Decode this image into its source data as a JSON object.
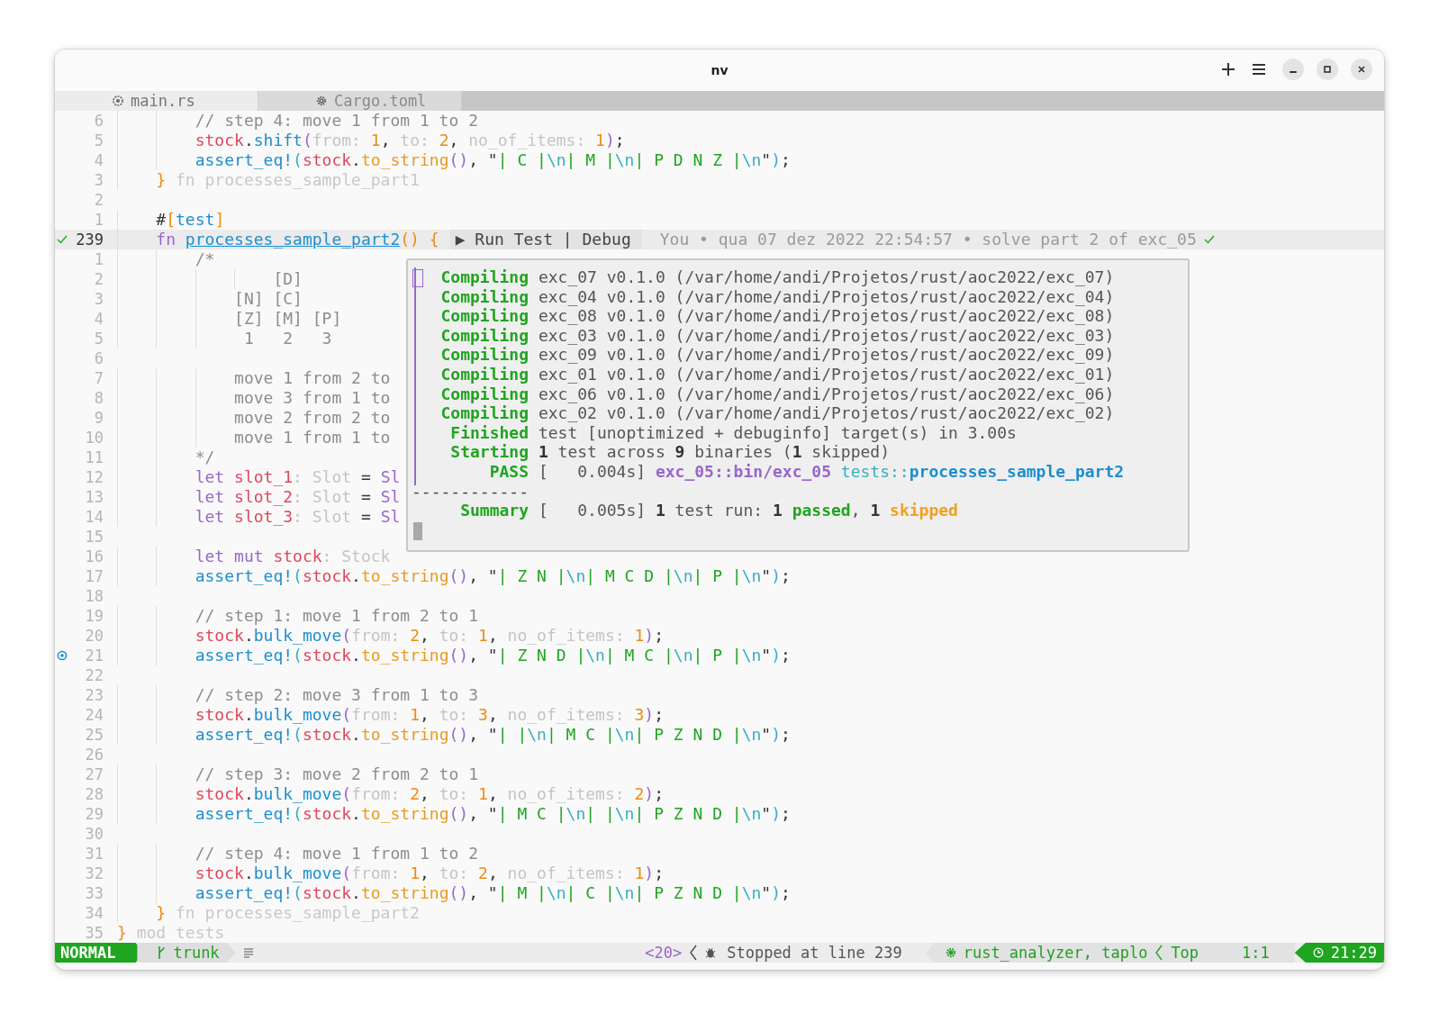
{
  "window": {
    "title": "nv"
  },
  "tabs": [
    {
      "label": "main.rs",
      "kind": "rust",
      "selected": true
    },
    {
      "label": "Cargo.toml",
      "kind": "toml",
      "selected": false
    }
  ],
  "editor": {
    "lines": [
      {
        "number": "6",
        "current": false,
        "tokens": [
          {
            "kind": "comment",
            "text": "        // step 4: move 1 from 1 to 2"
          }
        ]
      },
      {
        "number": "5",
        "current": false,
        "tokens": [
          {
            "kind": "var",
            "text": "        stock"
          },
          {
            "kind": "plain",
            "text": "."
          },
          {
            "kind": "fn",
            "text": "shift"
          },
          {
            "kind": "p2",
            "text": "("
          },
          {
            "kind": "hint",
            "text": "from: "
          },
          {
            "kind": "num",
            "text": "1"
          },
          {
            "kind": "plain",
            "text": ", "
          },
          {
            "kind": "hint",
            "text": "to: "
          },
          {
            "kind": "num",
            "text": "2"
          },
          {
            "kind": "plain",
            "text": ", "
          },
          {
            "kind": "hint",
            "text": "no_of_items: "
          },
          {
            "kind": "num",
            "text": "1"
          },
          {
            "kind": "p2",
            "text": ")"
          },
          {
            "kind": "plain",
            "text": ";"
          }
        ]
      },
      {
        "number": "4",
        "current": false,
        "tokens": [
          {
            "kind": "fn",
            "text": "        assert_eq!"
          },
          {
            "kind": "p1",
            "text": "("
          },
          {
            "kind": "var",
            "text": "stock"
          },
          {
            "kind": "plain",
            "text": "."
          },
          {
            "kind": "method",
            "text": "to_string"
          },
          {
            "kind": "p2",
            "text": "()"
          },
          {
            "kind": "plain",
            "text": ", \""
          },
          {
            "kind": "str",
            "text": "| C |"
          },
          {
            "kind": "esc",
            "text": "\\n"
          },
          {
            "kind": "str",
            "text": "| M |"
          },
          {
            "kind": "esc",
            "text": "\\n"
          },
          {
            "kind": "str",
            "text": "| P D N Z |"
          },
          {
            "kind": "esc",
            "text": "\\n"
          },
          {
            "kind": "plain",
            "text": "\""
          },
          {
            "kind": "p1",
            "text": ")"
          },
          {
            "kind": "plain",
            "text": ";"
          }
        ]
      },
      {
        "number": "3",
        "current": false,
        "tokens": [
          {
            "kind": "brace",
            "text": "    }"
          },
          {
            "kind": "ghost",
            "text": " fn processes_sample_part1"
          }
        ]
      },
      {
        "number": "2",
        "current": false
      },
      {
        "number": "1",
        "current": false,
        "tokens": [
          {
            "kind": "plain",
            "text": "    #"
          },
          {
            "kind": "brace",
            "text": "["
          },
          {
            "kind": "fn",
            "text": "test"
          },
          {
            "kind": "brace",
            "text": "]"
          }
        ]
      },
      {
        "number": "239",
        "current": true,
        "test_passed": true,
        "tokens": [
          {
            "kind": "kw",
            "text": "    fn "
          },
          {
            "kind": "fname",
            "text": "processes_sample_part2"
          },
          {
            "kind": "brace",
            "text": "()"
          },
          {
            "kind": "brace",
            "text": " {"
          }
        ],
        "lens": "▶ Run Test | Debug",
        "blame": "You • qua 07 dez 2022 22:54:57 • solve part 2 of exc_05"
      },
      {
        "number": "1",
        "current": false,
        "tokens": [
          {
            "kind": "comment",
            "text": "        /*"
          }
        ]
      },
      {
        "number": "2",
        "current": false,
        "tokens": [
          {
            "kind": "comment",
            "text": "                [D]"
          }
        ]
      },
      {
        "number": "3",
        "current": false,
        "tokens": [
          {
            "kind": "comment",
            "text": "            [N] [C]"
          }
        ]
      },
      {
        "number": "4",
        "current": false,
        "tokens": [
          {
            "kind": "comment",
            "text": "            [Z] [M] [P]"
          }
        ]
      },
      {
        "number": "5",
        "current": false,
        "tokens": [
          {
            "kind": "comment",
            "text": "             1   2   3"
          }
        ]
      },
      {
        "number": "6",
        "current": false
      },
      {
        "number": "7",
        "current": false,
        "tokens": [
          {
            "kind": "comment",
            "text": "            move 1 from 2 to"
          }
        ]
      },
      {
        "number": "8",
        "current": false,
        "tokens": [
          {
            "kind": "comment",
            "text": "            move 3 from 1 to"
          }
        ]
      },
      {
        "number": "9",
        "current": false,
        "tokens": [
          {
            "kind": "comment",
            "text": "            move 2 from 2 to"
          }
        ]
      },
      {
        "number": "10",
        "current": false,
        "tokens": [
          {
            "kind": "comment",
            "text": "            move 1 from 1 to"
          }
        ]
      },
      {
        "number": "11",
        "current": false,
        "tokens": [
          {
            "kind": "comment",
            "text": "        */"
          }
        ]
      },
      {
        "number": "12",
        "current": false,
        "tokens": [
          {
            "kind": "kw",
            "text": "        let "
          },
          {
            "kind": "var",
            "text": "slot_1"
          },
          {
            "kind": "hint",
            "text": ": Slot"
          },
          {
            "kind": "plain",
            "text": " = "
          },
          {
            "kind": "kw",
            "text": "Sl"
          }
        ]
      },
      {
        "number": "13",
        "current": false,
        "tokens": [
          {
            "kind": "kw",
            "text": "        let "
          },
          {
            "kind": "var",
            "text": "slot_2"
          },
          {
            "kind": "hint",
            "text": ": Slot"
          },
          {
            "kind": "plain",
            "text": " = "
          },
          {
            "kind": "kw",
            "text": "Sl"
          }
        ]
      },
      {
        "number": "14",
        "current": false,
        "tokens": [
          {
            "kind": "kw",
            "text": "        let "
          },
          {
            "kind": "var",
            "text": "slot_3"
          },
          {
            "kind": "hint",
            "text": ": Slot"
          },
          {
            "kind": "plain",
            "text": " = "
          },
          {
            "kind": "kw",
            "text": "Sl"
          }
        ]
      },
      {
        "number": "15",
        "current": false
      },
      {
        "number": "16",
        "current": false,
        "tokens": [
          {
            "kind": "kw",
            "text": "        let mut "
          },
          {
            "kind": "var",
            "text": "stock"
          },
          {
            "kind": "hint",
            "text": ": Stock"
          }
        ]
      },
      {
        "number": "17",
        "current": false,
        "tokens": [
          {
            "kind": "fn",
            "text": "        assert_eq!"
          },
          {
            "kind": "p1",
            "text": "("
          },
          {
            "kind": "var",
            "text": "stock"
          },
          {
            "kind": "plain",
            "text": "."
          },
          {
            "kind": "method",
            "text": "to_string"
          },
          {
            "kind": "p2",
            "text": "()"
          },
          {
            "kind": "plain",
            "text": ", \""
          },
          {
            "kind": "str",
            "text": "| Z N |"
          },
          {
            "kind": "esc",
            "text": "\\n"
          },
          {
            "kind": "str",
            "text": "| M C D |"
          },
          {
            "kind": "esc",
            "text": "\\n"
          },
          {
            "kind": "str",
            "text": "| P |"
          },
          {
            "kind": "esc",
            "text": "\\n"
          },
          {
            "kind": "plain",
            "text": "\""
          },
          {
            "kind": "p1",
            "text": ")"
          },
          {
            "kind": "plain",
            "text": ";"
          }
        ]
      },
      {
        "number": "18",
        "current": false
      },
      {
        "number": "19",
        "current": false,
        "tokens": [
          {
            "kind": "comment",
            "text": "        // step 1: move 1 from 2 to 1"
          }
        ]
      },
      {
        "number": "20",
        "current": false,
        "tokens": [
          {
            "kind": "var",
            "text": "        stock"
          },
          {
            "kind": "plain",
            "text": "."
          },
          {
            "kind": "fn",
            "text": "bulk_move"
          },
          {
            "kind": "p2",
            "text": "("
          },
          {
            "kind": "hint",
            "text": "from: "
          },
          {
            "kind": "num",
            "text": "2"
          },
          {
            "kind": "plain",
            "text": ", "
          },
          {
            "kind": "hint",
            "text": "to: "
          },
          {
            "kind": "num",
            "text": "1"
          },
          {
            "kind": "plain",
            "text": ", "
          },
          {
            "kind": "hint",
            "text": "no_of_items: "
          },
          {
            "kind": "num",
            "text": "1"
          },
          {
            "kind": "p2",
            "text": ")"
          },
          {
            "kind": "plain",
            "text": ";"
          }
        ]
      },
      {
        "number": "21",
        "current": false,
        "breakpoint": true,
        "tokens": [
          {
            "kind": "fn",
            "text": "        assert_eq!"
          },
          {
            "kind": "p1",
            "text": "("
          },
          {
            "kind": "var",
            "text": "stock"
          },
          {
            "kind": "plain",
            "text": "."
          },
          {
            "kind": "method",
            "text": "to_string"
          },
          {
            "kind": "p2",
            "text": "()"
          },
          {
            "kind": "plain",
            "text": ", \""
          },
          {
            "kind": "str",
            "text": "| Z N D |"
          },
          {
            "kind": "esc",
            "text": "\\n"
          },
          {
            "kind": "str",
            "text": "| M C |"
          },
          {
            "kind": "esc",
            "text": "\\n"
          },
          {
            "kind": "str",
            "text": "| P |"
          },
          {
            "kind": "esc",
            "text": "\\n"
          },
          {
            "kind": "plain",
            "text": "\""
          },
          {
            "kind": "p1",
            "text": ")"
          },
          {
            "kind": "plain",
            "text": ";"
          }
        ]
      },
      {
        "number": "22",
        "current": false
      },
      {
        "number": "23",
        "current": false,
        "tokens": [
          {
            "kind": "comment",
            "text": "        // step 2: move 3 from 1 to 3"
          }
        ]
      },
      {
        "number": "24",
        "current": false,
        "tokens": [
          {
            "kind": "var",
            "text": "        stock"
          },
          {
            "kind": "plain",
            "text": "."
          },
          {
            "kind": "fn",
            "text": "bulk_move"
          },
          {
            "kind": "p2",
            "text": "("
          },
          {
            "kind": "hint",
            "text": "from: "
          },
          {
            "kind": "num",
            "text": "1"
          },
          {
            "kind": "plain",
            "text": ", "
          },
          {
            "kind": "hint",
            "text": "to: "
          },
          {
            "kind": "num",
            "text": "3"
          },
          {
            "kind": "plain",
            "text": ", "
          },
          {
            "kind": "hint",
            "text": "no_of_items: "
          },
          {
            "kind": "num",
            "text": "3"
          },
          {
            "kind": "p2",
            "text": ")"
          },
          {
            "kind": "plain",
            "text": ";"
          }
        ]
      },
      {
        "number": "25",
        "current": false,
        "tokens": [
          {
            "kind": "fn",
            "text": "        assert_eq!"
          },
          {
            "kind": "p1",
            "text": "("
          },
          {
            "kind": "var",
            "text": "stock"
          },
          {
            "kind": "plain",
            "text": "."
          },
          {
            "kind": "method",
            "text": "to_string"
          },
          {
            "kind": "p2",
            "text": "()"
          },
          {
            "kind": "plain",
            "text": ", \""
          },
          {
            "kind": "str",
            "text": "| |"
          },
          {
            "kind": "esc",
            "text": "\\n"
          },
          {
            "kind": "str",
            "text": "| M C |"
          },
          {
            "kind": "esc",
            "text": "\\n"
          },
          {
            "kind": "str",
            "text": "| P Z N D |"
          },
          {
            "kind": "esc",
            "text": "\\n"
          },
          {
            "kind": "plain",
            "text": "\""
          },
          {
            "kind": "p1",
            "text": ")"
          },
          {
            "kind": "plain",
            "text": ";"
          }
        ]
      },
      {
        "number": "26",
        "current": false
      },
      {
        "number": "27",
        "current": false,
        "tokens": [
          {
            "kind": "comment",
            "text": "        // step 3: move 2 from 2 to 1"
          }
        ]
      },
      {
        "number": "28",
        "current": false,
        "tokens": [
          {
            "kind": "var",
            "text": "        stock"
          },
          {
            "kind": "plain",
            "text": "."
          },
          {
            "kind": "fn",
            "text": "bulk_move"
          },
          {
            "kind": "p2",
            "text": "("
          },
          {
            "kind": "hint",
            "text": "from: "
          },
          {
            "kind": "num",
            "text": "2"
          },
          {
            "kind": "plain",
            "text": ", "
          },
          {
            "kind": "hint",
            "text": "to: "
          },
          {
            "kind": "num",
            "text": "1"
          },
          {
            "kind": "plain",
            "text": ", "
          },
          {
            "kind": "hint",
            "text": "no_of_items: "
          },
          {
            "kind": "num",
            "text": "2"
          },
          {
            "kind": "p2",
            "text": ")"
          },
          {
            "kind": "plain",
            "text": ";"
          }
        ]
      },
      {
        "number": "29",
        "current": false,
        "tokens": [
          {
            "kind": "fn",
            "text": "        assert_eq!"
          },
          {
            "kind": "p1",
            "text": "("
          },
          {
            "kind": "var",
            "text": "stock"
          },
          {
            "kind": "plain",
            "text": "."
          },
          {
            "kind": "method",
            "text": "to_string"
          },
          {
            "kind": "p2",
            "text": "()"
          },
          {
            "kind": "plain",
            "text": ", \""
          },
          {
            "kind": "str",
            "text": "| M C |"
          },
          {
            "kind": "esc",
            "text": "\\n"
          },
          {
            "kind": "str",
            "text": "| |"
          },
          {
            "kind": "esc",
            "text": "\\n"
          },
          {
            "kind": "str",
            "text": "| P Z N D |"
          },
          {
            "kind": "esc",
            "text": "\\n"
          },
          {
            "kind": "plain",
            "text": "\""
          },
          {
            "kind": "p1",
            "text": ")"
          },
          {
            "kind": "plain",
            "text": ";"
          }
        ]
      },
      {
        "number": "30",
        "current": false
      },
      {
        "number": "31",
        "current": false,
        "tokens": [
          {
            "kind": "comment",
            "text": "        // step 4: move 1 from 1 to 2"
          }
        ]
      },
      {
        "number": "32",
        "current": false,
        "tokens": [
          {
            "kind": "var",
            "text": "        stock"
          },
          {
            "kind": "plain",
            "text": "."
          },
          {
            "kind": "fn",
            "text": "bulk_move"
          },
          {
            "kind": "p2",
            "text": "("
          },
          {
            "kind": "hint",
            "text": "from: "
          },
          {
            "kind": "num",
            "text": "1"
          },
          {
            "kind": "plain",
            "text": ", "
          },
          {
            "kind": "hint",
            "text": "to: "
          },
          {
            "kind": "num",
            "text": "2"
          },
          {
            "kind": "plain",
            "text": ", "
          },
          {
            "kind": "hint",
            "text": "no_of_items: "
          },
          {
            "kind": "num",
            "text": "1"
          },
          {
            "kind": "p2",
            "text": ")"
          },
          {
            "kind": "plain",
            "text": ";"
          }
        ]
      },
      {
        "number": "33",
        "current": false,
        "tokens": [
          {
            "kind": "fn",
            "text": "        assert_eq!"
          },
          {
            "kind": "p1",
            "text": "("
          },
          {
            "kind": "var",
            "text": "stock"
          },
          {
            "kind": "plain",
            "text": "."
          },
          {
            "kind": "method",
            "text": "to_string"
          },
          {
            "kind": "p2",
            "text": "()"
          },
          {
            "kind": "plain",
            "text": ", \""
          },
          {
            "kind": "str",
            "text": "| M |"
          },
          {
            "kind": "esc",
            "text": "\\n"
          },
          {
            "kind": "str",
            "text": "| C |"
          },
          {
            "kind": "esc",
            "text": "\\n"
          },
          {
            "kind": "str",
            "text": "| P Z N D |"
          },
          {
            "kind": "esc",
            "text": "\\n"
          },
          {
            "kind": "plain",
            "text": "\""
          },
          {
            "kind": "p1",
            "text": ")"
          },
          {
            "kind": "plain",
            "text": ";"
          }
        ]
      },
      {
        "number": "34",
        "current": false,
        "tokens": [
          {
            "kind": "brace",
            "text": "    }"
          },
          {
            "kind": "ghost",
            "text": " fn processes_sample_part2"
          }
        ]
      },
      {
        "number": "35",
        "current": false,
        "tokens": [
          {
            "kind": "brace",
            "text": "}"
          },
          {
            "kind": "ghost",
            "text": " mod tests"
          }
        ]
      }
    ]
  },
  "popup": {
    "rows": [
      {
        "kind": "log",
        "label": "Compiling",
        "segments": [
          {
            "kind": "plain",
            "text": "exc_07 v0.1.0 (/var/home/andi/Projetos/rust/aoc2022/exc_07)"
          }
        ]
      },
      {
        "kind": "log",
        "label": "Compiling",
        "segments": [
          {
            "kind": "plain",
            "text": "exc_04 v0.1.0 (/var/home/andi/Projetos/rust/aoc2022/exc_04)"
          }
        ]
      },
      {
        "kind": "log",
        "label": "Compiling",
        "segments": [
          {
            "kind": "plain",
            "text": "exc_08 v0.1.0 (/var/home/andi/Projetos/rust/aoc2022/exc_08)"
          }
        ]
      },
      {
        "kind": "log",
        "label": "Compiling",
        "segments": [
          {
            "kind": "plain",
            "text": "exc_03 v0.1.0 (/var/home/andi/Projetos/rust/aoc2022/exc_03)"
          }
        ]
      },
      {
        "kind": "log",
        "label": "Compiling",
        "segments": [
          {
            "kind": "plain",
            "text": "exc_09 v0.1.0 (/var/home/andi/Projetos/rust/aoc2022/exc_09)"
          }
        ]
      },
      {
        "kind": "log",
        "label": "Compiling",
        "segments": [
          {
            "kind": "plain",
            "text": "exc_01 v0.1.0 (/var/home/andi/Projetos/rust/aoc2022/exc_01)"
          }
        ]
      },
      {
        "kind": "log",
        "label": "Compiling",
        "segments": [
          {
            "kind": "plain",
            "text": "exc_06 v0.1.0 (/var/home/andi/Projetos/rust/aoc2022/exc_06)"
          }
        ]
      },
      {
        "kind": "log",
        "label": "Compiling",
        "segments": [
          {
            "kind": "plain",
            "text": "exc_02 v0.1.0 (/var/home/andi/Projetos/rust/aoc2022/exc_02)"
          }
        ]
      },
      {
        "kind": "log",
        "label": "Finished",
        "segments": [
          {
            "kind": "plain",
            "text": "test [unoptimized + debuginfo] target(s) in 3.00s"
          }
        ]
      },
      {
        "kind": "log",
        "label": "Starting",
        "segments": [
          {
            "kind": "bold",
            "text": "1"
          },
          {
            "kind": "plain",
            "text": " test across "
          },
          {
            "kind": "bold",
            "text": "9"
          },
          {
            "kind": "plain",
            "text": " binaries ("
          },
          {
            "kind": "bold",
            "text": "1"
          },
          {
            "kind": "plain",
            "text": " skipped)"
          }
        ]
      },
      {
        "kind": "log",
        "label": "PASS",
        "segments": [
          {
            "kind": "plain",
            "text": "[   0.004s] "
          },
          {
            "kind": "purple",
            "text": "exc_05::bin/exc_05"
          },
          {
            "kind": "teal",
            "text": " tests::"
          },
          {
            "kind": "blue",
            "text": "processes_sample_part2"
          }
        ]
      },
      {
        "kind": "rule",
        "text": "------------"
      },
      {
        "kind": "summary",
        "label": "Summary",
        "segments": [
          {
            "kind": "plain",
            "text": "[   0.005s] "
          },
          {
            "kind": "bold",
            "text": "1"
          },
          {
            "kind": "plain",
            "text": " test run: "
          },
          {
            "kind": "bold",
            "text": "1"
          },
          {
            "kind": "green",
            "text": " passed"
          },
          {
            "kind": "plain",
            "text": ", "
          },
          {
            "kind": "bold",
            "text": "1"
          },
          {
            "kind": "orange",
            "text": " skipped"
          }
        ]
      },
      {
        "kind": "cursor"
      }
    ]
  },
  "status_bar": {
    "mode": "NORMAL",
    "branch": "trunk",
    "lsp_progress": "<20>",
    "debug_status": "Stopped at line 239",
    "lsp_clients": "rust_analyzer, taplo",
    "scroll": "Top",
    "position": "1:1",
    "clock": "21:29"
  }
}
